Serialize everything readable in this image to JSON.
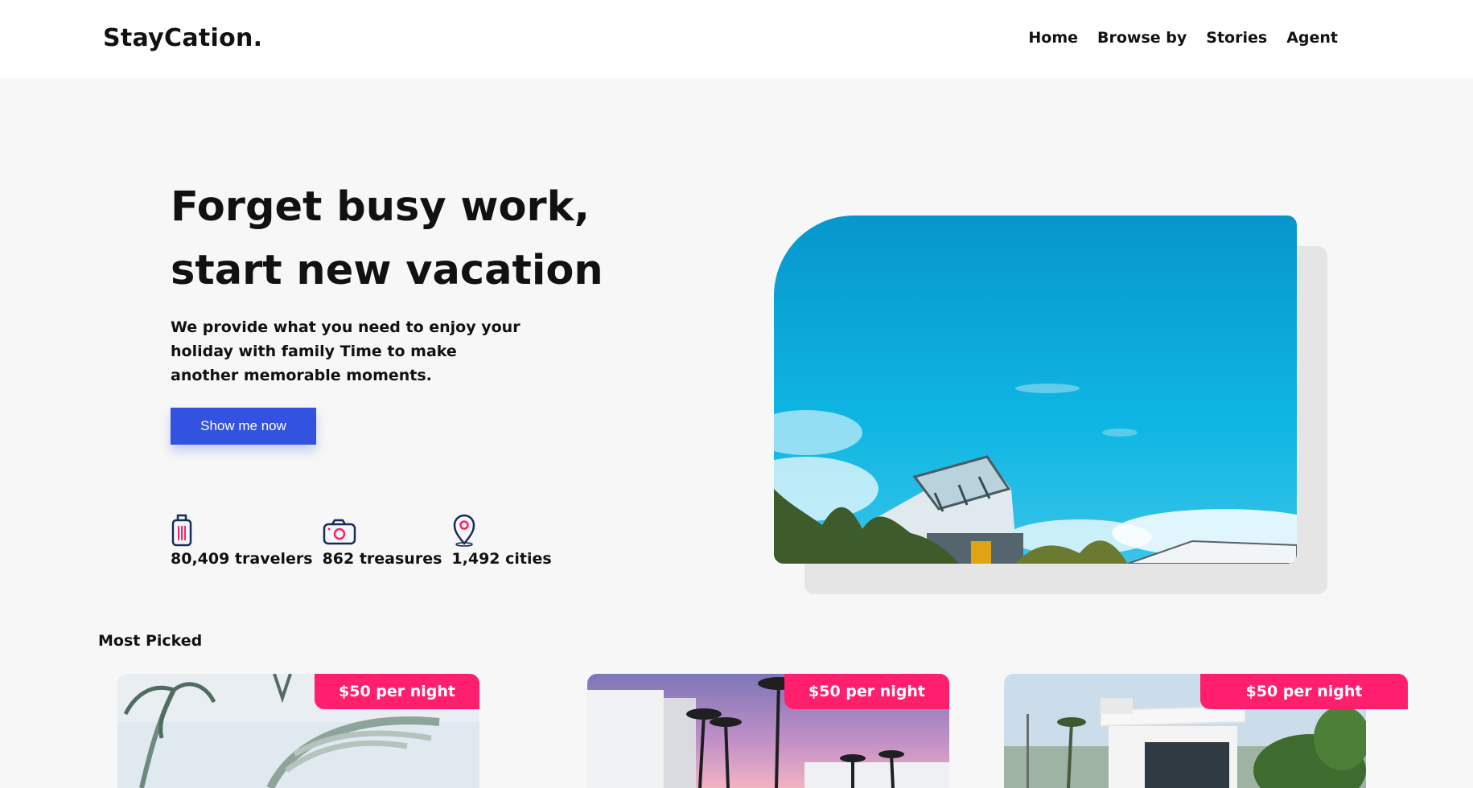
{
  "header": {
    "brand": "StayCation.",
    "nav": [
      "Home",
      "Browse by",
      "Stories",
      "Agent"
    ]
  },
  "hero": {
    "title_line1": "Forget busy work,",
    "title_line2": "start new vacation",
    "description": "We provide what you need to enjoy your holiday with family Time to make another memorable moments.",
    "cta_label": "Show me now",
    "stats": [
      {
        "icon": "suitcase-icon",
        "label": "80,409 travelers"
      },
      {
        "icon": "camera-icon",
        "label": "862 treasures"
      },
      {
        "icon": "map-pin-icon",
        "label": "1,492 cities"
      }
    ]
  },
  "most_picked": {
    "title": "Most Picked",
    "cards": [
      {
        "price_label": "$50 per night"
      },
      {
        "price_label": "$50 per night"
      },
      {
        "price_label": "$50 per night"
      }
    ]
  },
  "colors": {
    "primary": "#3252df",
    "accent": "#ff1f6c",
    "navy": "#152c5b",
    "text": "#111111"
  }
}
